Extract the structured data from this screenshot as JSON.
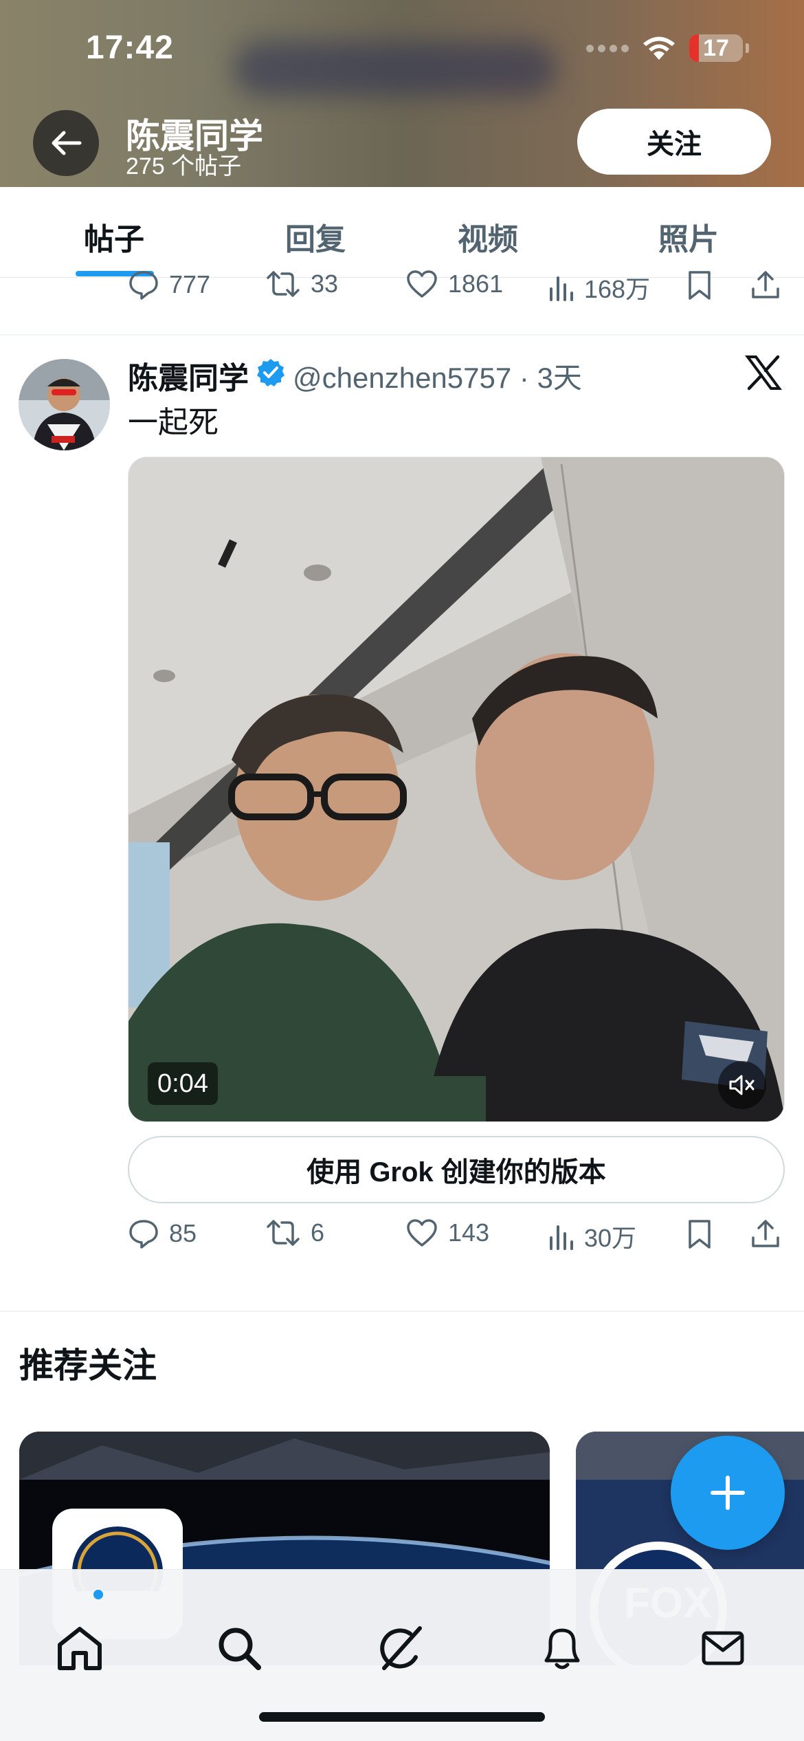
{
  "status_bar": {
    "time": "17:42",
    "battery": "17"
  },
  "header": {
    "title": "陈震同学",
    "subtitle": "275 个帖子",
    "follow_label": "关注"
  },
  "tabs": [
    {
      "label": "帖子",
      "active": true
    },
    {
      "label": "回复",
      "active": false
    },
    {
      "label": "视频",
      "active": false
    },
    {
      "label": "照片",
      "active": false
    }
  ],
  "prev_post": {
    "replies": "777",
    "reposts": "33",
    "likes": "1861",
    "views": "168万"
  },
  "post": {
    "author": "陈震同学",
    "handle": "@chenzhen5757",
    "time": "3天",
    "text": "一起死",
    "video_time": "0:04",
    "grok_label": "使用 Grok 创建你的版本",
    "replies": "85",
    "reposts": "6",
    "likes": "143",
    "views": "30万"
  },
  "recommend": {
    "title": "推荐关注"
  },
  "colors": {
    "accent": "#1d9bf0",
    "text": "#0f1419",
    "muted": "#536471"
  },
  "nav": [
    "home-icon",
    "search-icon",
    "grok-icon",
    "bell-icon",
    "mail-icon"
  ]
}
